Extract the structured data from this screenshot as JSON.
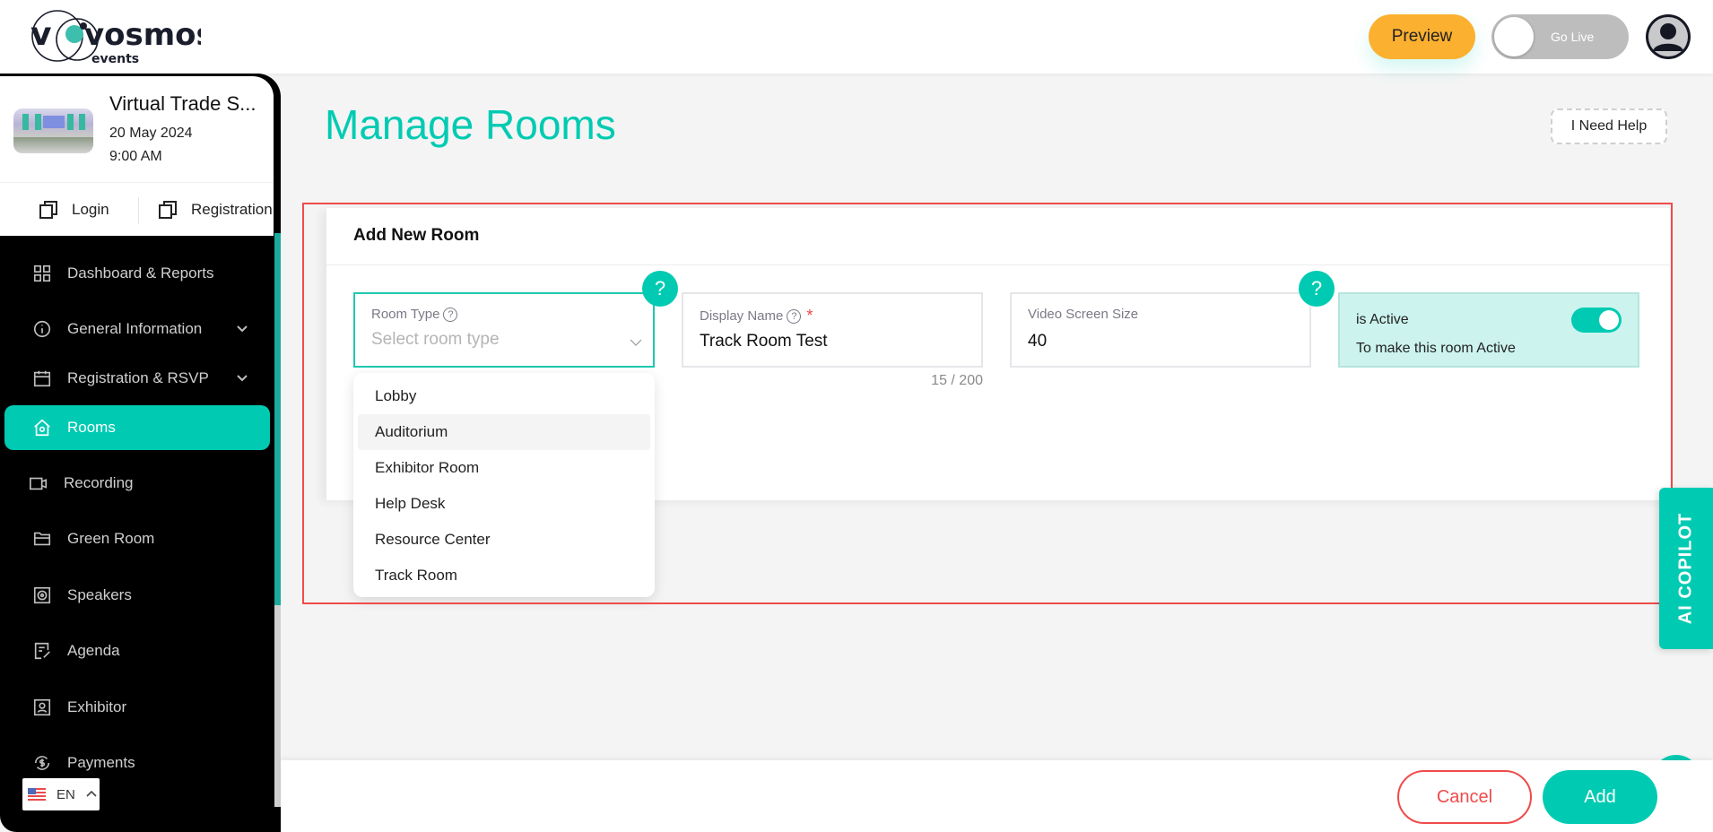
{
  "header": {
    "logo_text": "vosmos",
    "logo_subtext": "events",
    "preview_label": "Preview",
    "golive_label": "Go Live",
    "golive_on": false
  },
  "event": {
    "title": "Virtual Trade S...",
    "date": "20 May 2024",
    "time": "9:00 AM",
    "links": [
      {
        "label": "Login",
        "icon": "copy-icon"
      },
      {
        "label": "Registration",
        "icon": "copy-icon"
      }
    ]
  },
  "sidebar": {
    "items": [
      {
        "label": "Dashboard & Reports",
        "icon": "grid-icon",
        "expandable": false,
        "active": false
      },
      {
        "label": "General Information",
        "icon": "info-icon",
        "expandable": true,
        "active": false
      },
      {
        "label": "Registration & RSVP",
        "icon": "calendar-icon",
        "expandable": true,
        "active": false
      },
      {
        "label": "Rooms",
        "icon": "house-icon",
        "expandable": false,
        "active": true
      },
      {
        "label": "Recording",
        "icon": "video-icon",
        "expandable": false,
        "active": false
      },
      {
        "label": "Green Room",
        "icon": "folder-icon",
        "expandable": false,
        "active": false
      },
      {
        "label": "Speakers",
        "icon": "speaker-icon",
        "expandable": false,
        "active": false
      },
      {
        "label": "Agenda",
        "icon": "agenda-icon",
        "expandable": false,
        "active": false
      },
      {
        "label": "Exhibitor",
        "icon": "exhibitor-icon",
        "expandable": false,
        "active": false
      },
      {
        "label": "Payments",
        "icon": "payments-icon",
        "expandable": false,
        "active": false
      }
    ],
    "language": "EN"
  },
  "main": {
    "page_title": "Manage Rooms",
    "help_label": "I Need Help",
    "card_title": "Add New Room",
    "room_type": {
      "label": "Room Type",
      "placeholder": "Select room type",
      "options": [
        "Lobby",
        "Auditorium",
        "Exhibitor Room",
        "Help Desk",
        "Resource Center",
        "Track Room"
      ],
      "hovered_option": "Auditorium"
    },
    "display_name": {
      "label": "Display Name",
      "required_mark": "*",
      "value": "Track Room Test",
      "counter": "15 / 200"
    },
    "video_screen_size": {
      "label": "Video Screen Size",
      "value": "40"
    },
    "is_active": {
      "label": "is Active",
      "description": "To make this room Active",
      "value": true
    },
    "help_bubble": "?"
  },
  "copilot_label": "AI COPILOT",
  "footer": {
    "cancel_label": "Cancel",
    "add_label": "Add"
  },
  "colors": {
    "accent": "#00cbb2",
    "preview": "#fbb030",
    "danger": "#ef4b4b"
  }
}
